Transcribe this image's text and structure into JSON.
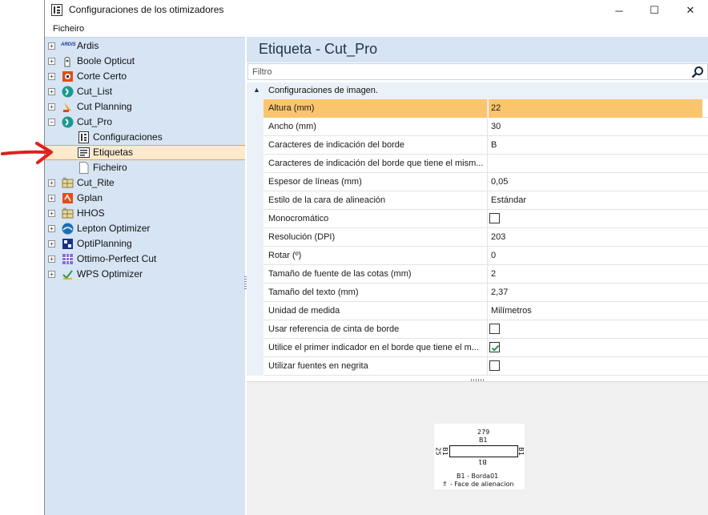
{
  "window": {
    "title": "Configuraciones de los otimizadores",
    "minimize": "─",
    "maximize": "☐",
    "close": "✕"
  },
  "menu": {
    "file": "Ficheiro"
  },
  "tree": {
    "items": [
      {
        "label": "Ardis",
        "icon": "ardis-logo-icon",
        "expander": "+"
      },
      {
        "label": "Boole Opticut",
        "icon": "boole-opticut-icon",
        "expander": "+"
      },
      {
        "label": "Corte Certo",
        "icon": "corte-certo-icon",
        "expander": "+"
      },
      {
        "label": "Cut_List",
        "icon": "cut-list-icon",
        "expander": "+"
      },
      {
        "label": "Cut Planning",
        "icon": "cut-planning-icon",
        "expander": "+"
      },
      {
        "label": "Cut_Pro",
        "icon": "cut-pro-icon",
        "expander": "−"
      },
      {
        "label": "Configuraciones",
        "icon": "settings-document-icon"
      },
      {
        "label": "Etiquetas",
        "icon": "label-icon"
      },
      {
        "label": "Ficheiro",
        "icon": "file-icon"
      },
      {
        "label": "Cut_Rite",
        "icon": "cut-rite-icon",
        "expander": "+"
      },
      {
        "label": "Gplan",
        "icon": "gplan-icon",
        "expander": "+"
      },
      {
        "label": "HHOS",
        "icon": "hhos-icon",
        "expander": "+"
      },
      {
        "label": "Lepton Optimizer",
        "icon": "lepton-optimizer-icon",
        "expander": "+"
      },
      {
        "label": "OptiPlanning",
        "icon": "optiplanning-icon",
        "expander": "+"
      },
      {
        "label": "Ottimo-Perfect Cut",
        "icon": "ottimo-perfect-cut-icon",
        "expander": "+"
      },
      {
        "label": "WPS Optimizer",
        "icon": "wps-optimizer-icon",
        "expander": "+"
      }
    ],
    "ardis_logo_text": "ARDIS"
  },
  "panel": {
    "title": "Etiqueta - Cut_Pro",
    "filter_placeholder": "Filtro",
    "category": "Configuraciones de imagen.",
    "properties": [
      {
        "name": "Altura (mm)",
        "value": "22"
      },
      {
        "name": "Ancho (mm)",
        "value": "30"
      },
      {
        "name": "Caracteres de indicación del borde",
        "value": "B"
      },
      {
        "name": "Caracteres de indicación del borde que tiene el mism...",
        "value": ""
      },
      {
        "name": "Espesor de líneas (mm)",
        "value": "0,05"
      },
      {
        "name": "Estilo de la cara de alineación",
        "value": "Estándar"
      },
      {
        "name": "Monocromático",
        "value": "",
        "checkbox": false
      },
      {
        "name": "Resolución (DPI)",
        "value": "203"
      },
      {
        "name": "Rotar (º)",
        "value": "0"
      },
      {
        "name": "Tamaño de fuente de las cotas (mm)",
        "value": "2"
      },
      {
        "name": "Tamaño del texto (mm)",
        "value": "2,37"
      },
      {
        "name": "Unidad de medida",
        "value": "Milímetros"
      },
      {
        "name": "Usar referencia de cinta de borde",
        "value": "",
        "checkbox": false
      },
      {
        "name": "Utilice el primer indicador en el borde que tiene el m...",
        "value": "",
        "checkbox": true
      },
      {
        "name": "Utilizar fuentes en negrita",
        "value": "",
        "checkbox": false
      }
    ]
  },
  "preview": {
    "width": "279",
    "top_edge": "B1",
    "bottom_edge": "B1",
    "left_edge": "B1",
    "right_edge": "B1",
    "left_height": "25",
    "legend_edge": "B1 - Borda01",
    "legend_face": "- Face de alienacion"
  },
  "colors": {
    "accent": "#f0a14a",
    "selection": "#fbc56e",
    "pane_blue": "#d6e4f4",
    "arrow_red": "#e02020"
  }
}
